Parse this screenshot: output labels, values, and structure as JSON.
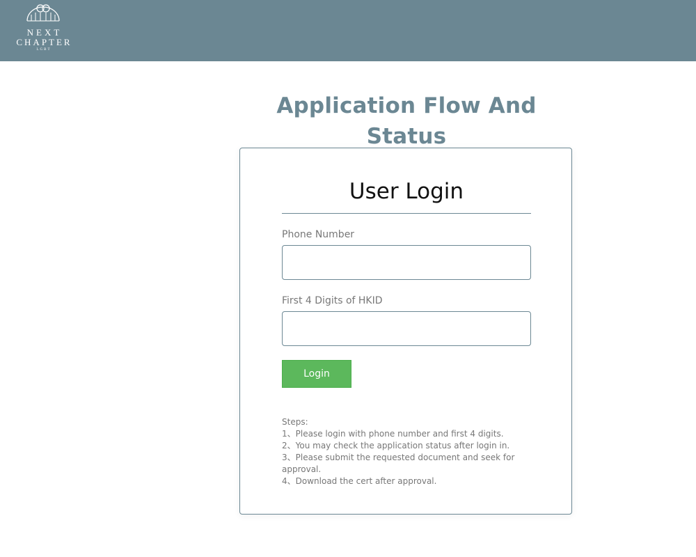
{
  "header": {
    "logo": {
      "line1": "NEXT",
      "line2": "CHAPTER",
      "line3": "LGBT"
    },
    "background_color": "#6b8793"
  },
  "main": {
    "title": "Application Flow And Status"
  },
  "login_card": {
    "title": "User Login",
    "phone": {
      "label": "Phone Number",
      "value": "",
      "placeholder": ""
    },
    "hkid": {
      "label": "First 4 Digits of HKID",
      "value": "",
      "placeholder": ""
    },
    "login_button_label": "Login",
    "steps": {
      "heading": "Steps:",
      "items": [
        "1、Please login with phone number and first 4 digits.",
        "2、You may check the application status after login in.",
        "3、Please submit the requested document and seek for approval.",
        "4、Download the cert after approval."
      ]
    }
  },
  "colors": {
    "accent": "#6b8793",
    "button": "#5cb85c",
    "muted_text": "#777777"
  }
}
